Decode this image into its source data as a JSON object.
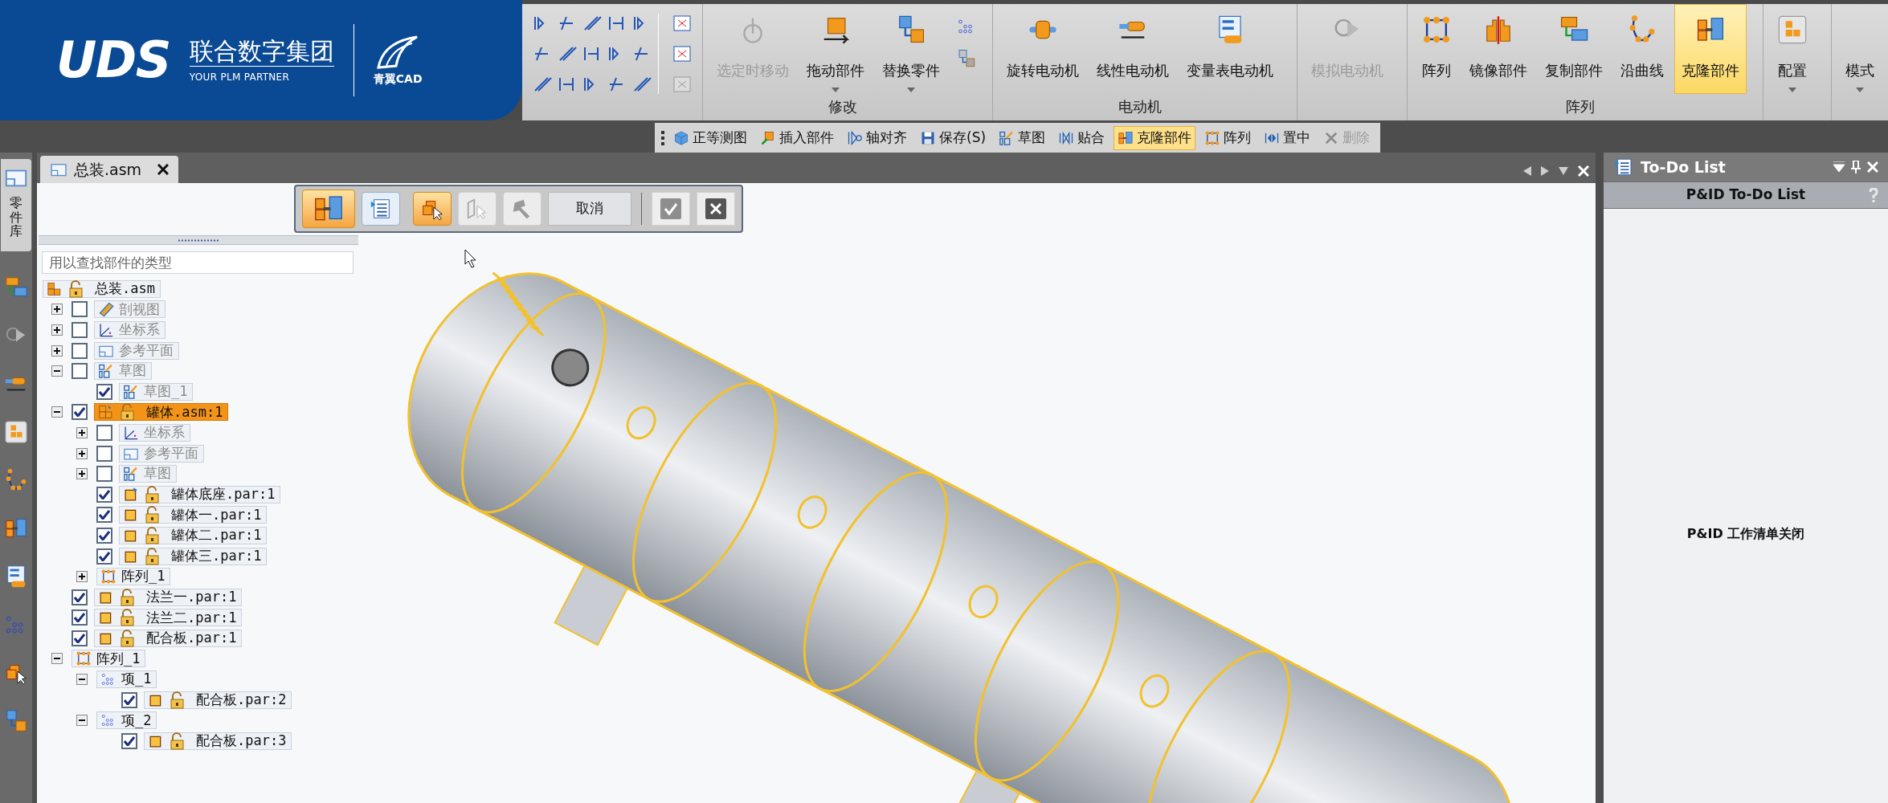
{
  "logo": {
    "brand": "UDS",
    "company": "联合数字集团",
    "tagline": "YOUR PLM PARTNER",
    "product": "青翼CAD"
  },
  "ribbon": {
    "groups": [
      {
        "label": "修改",
        "buttons": [
          {
            "label": "选定时移动",
            "kind": "move",
            "disabled": true,
            "selected": false,
            "dropdown": false
          },
          {
            "label": "拖动部件",
            "kind": "drag",
            "disabled": false,
            "selected": false,
            "dropdown": true
          },
          {
            "label": "替换零件",
            "kind": "replace",
            "disabled": false,
            "selected": false,
            "dropdown": true
          }
        ],
        "side_tools": true
      },
      {
        "label": "电动机",
        "buttons": [
          {
            "label": "旋转电动机",
            "kind": "rotary",
            "disabled": false,
            "selected": false,
            "dropdown": false
          },
          {
            "label": "线性电动机",
            "kind": "linear",
            "disabled": false,
            "selected": false,
            "dropdown": false
          },
          {
            "label": "变量表电动机",
            "kind": "table",
            "disabled": false,
            "selected": false,
            "dropdown": false
          }
        ],
        "side_tools": false
      },
      {
        "buttons": [
          {
            "label": "模拟电动机",
            "kind": "simulate",
            "disabled": true,
            "selected": false,
            "dropdown": false
          }
        ],
        "side_tools": false
      },
      {
        "label": "阵列",
        "buttons": [
          {
            "label": "阵列",
            "kind": "pattern",
            "disabled": false,
            "selected": false,
            "dropdown": false
          },
          {
            "label": "镜像部件",
            "kind": "mirror",
            "disabled": false,
            "selected": false,
            "dropdown": false
          },
          {
            "label": "复制部件",
            "kind": "copy",
            "disabled": false,
            "selected": false,
            "dropdown": false
          },
          {
            "label": "沿曲线",
            "kind": "curve",
            "disabled": false,
            "selected": false,
            "dropdown": false
          },
          {
            "label": "克隆部件",
            "kind": "clone",
            "disabled": false,
            "selected": true,
            "dropdown": false
          }
        ],
        "side_tools": false
      },
      {
        "buttons": [
          {
            "label": "配置",
            "kind": "config",
            "disabled": false,
            "selected": false,
            "dropdown": true
          }
        ],
        "side_tools": false
      },
      {
        "buttons": [
          {
            "label": "模式",
            "kind": "none",
            "disabled": false,
            "selected": false,
            "dropdown": true
          }
        ],
        "side_tools": false
      }
    ]
  },
  "quick_toolbar": [
    {
      "label": "正等测图",
      "kind": "cube",
      "selected": false,
      "disabled": false
    },
    {
      "label": "插入部件",
      "kind": "insert",
      "selected": false,
      "disabled": false
    },
    {
      "label": "轴对齐",
      "kind": "axis",
      "selected": false,
      "disabled": false
    },
    {
      "label": "保存(S)",
      "kind": "save",
      "selected": false,
      "disabled": false
    },
    {
      "label": "草图",
      "kind": "sketch",
      "selected": false,
      "disabled": false
    },
    {
      "label": "贴合",
      "kind": "mate",
      "selected": false,
      "disabled": false
    },
    {
      "label": "克隆部件",
      "kind": "clone",
      "selected": true,
      "disabled": false
    },
    {
      "label": "阵列",
      "kind": "pattern",
      "selected": false,
      "disabled": false
    },
    {
      "label": "置中",
      "kind": "center",
      "selected": false,
      "disabled": false
    },
    {
      "label": "删除",
      "kind": "delete",
      "selected": false,
      "disabled": true
    }
  ],
  "side_strip": {
    "tab": {
      "label": "零件库",
      "selected": true
    }
  },
  "document": {
    "tab": {
      "label": "总装.asm",
      "selected": true
    },
    "command_bar": {
      "buttons": [
        {
          "kind": "clone",
          "selected": true,
          "disabled": false
        },
        {
          "kind": "list",
          "selected": false,
          "disabled": false
        },
        {
          "kind": "select-parts",
          "selected": true,
          "disabled": false
        },
        {
          "kind": "select-face",
          "selected": false,
          "disabled": true
        },
        {
          "kind": "zone",
          "selected": false,
          "disabled": true
        }
      ],
      "cancel": "取消"
    },
    "search": {
      "placeholder": "用以查找部件的类型"
    },
    "tree": [
      {
        "label": "总装.asm",
        "kind": "assembly",
        "lock": true,
        "selected": false,
        "dimmed": false,
        "children": [
          {
            "label": "剖视图",
            "kind": "section",
            "lock": false,
            "checked": false,
            "expanded": false,
            "selected": false,
            "dimmed": true
          },
          {
            "label": "坐标系",
            "kind": "coords",
            "lock": false,
            "checked": false,
            "expanded": false,
            "selected": false,
            "dimmed": true
          },
          {
            "label": "参考平面",
            "kind": "plane",
            "lock": false,
            "checked": false,
            "expanded": false,
            "selected": false,
            "dimmed": true
          },
          {
            "label": "草图",
            "kind": "sketch",
            "lock": false,
            "checked": false,
            "expanded": true,
            "selected": false,
            "dimmed": true,
            "children": [
              {
                "label": "草图_1",
                "kind": "sketch",
                "lock": false,
                "checked": true,
                "selected": false,
                "dimmed": true
              }
            ]
          },
          {
            "label": "罐体.asm:1",
            "kind": "subassembly",
            "lock": true,
            "checked": true,
            "expanded": true,
            "selected": true,
            "dimmed": false,
            "children": [
              {
                "label": "坐标系",
                "kind": "coords",
                "lock": false,
                "checked": false,
                "expanded": false,
                "selected": false,
                "dimmed": true
              },
              {
                "label": "参考平面",
                "kind": "plane",
                "lock": false,
                "checked": false,
                "expanded": false,
                "selected": false,
                "dimmed": true
              },
              {
                "label": "草图",
                "kind": "sketch",
                "lock": false,
                "checked": false,
                "expanded": false,
                "selected": false,
                "dimmed": true
              },
              {
                "label": "罐体底座.par:1",
                "kind": "part-base",
                "lock": true,
                "checked": true,
                "selected": false,
                "dimmed": false
              },
              {
                "label": "罐体一.par:1",
                "kind": "part",
                "lock": true,
                "checked": true,
                "selected": false,
                "dimmed": false
              },
              {
                "label": "罐体二.par:1",
                "kind": "part",
                "lock": true,
                "checked": true,
                "selected": false,
                "dimmed": false
              },
              {
                "label": "罐体三.par:1",
                "kind": "part",
                "lock": true,
                "checked": true,
                "selected": false,
                "dimmed": false
              },
              {
                "label": "阵列_1",
                "kind": "pattern",
                "lock": false,
                "expanded": false,
                "selected": false,
                "dimmed": false
              }
            ]
          },
          {
            "label": "法兰一.par:1",
            "kind": "part",
            "lock": true,
            "checked": true,
            "selected": false,
            "dimmed": false
          },
          {
            "label": "法兰二.par:1",
            "kind": "part",
            "lock": true,
            "checked": true,
            "selected": false,
            "dimmed": false
          },
          {
            "label": "配合板.par:1",
            "kind": "part",
            "lock": true,
            "checked": true,
            "selected": false,
            "dimmed": false
          },
          {
            "label": "阵列_1",
            "kind": "pattern",
            "lock": false,
            "expanded": true,
            "selected": false,
            "dimmed": false,
            "children": [
              {
                "label": "项_1",
                "kind": "pattern-item",
                "lock": false,
                "expanded": true,
                "selected": false,
                "dimmed": false,
                "children": [
                  {
                    "label": "配合板.par:2",
                    "kind": "part",
                    "lock": true,
                    "checked": true,
                    "selected": false,
                    "dimmed": false
                  }
                ]
              },
              {
                "label": "项_2",
                "kind": "pattern-item",
                "lock": false,
                "expanded": true,
                "selected": false,
                "dimmed": false,
                "children": [
                  {
                    "label": "配合板.par:3",
                    "kind": "part",
                    "lock": true,
                    "checked": true,
                    "selected": false,
                    "dimmed": false
                  }
                ]
              }
            ]
          }
        ]
      }
    ]
  },
  "todo_panel": {
    "title": "To-Do List",
    "subtitle": "P&ID To-Do List",
    "message": "P&ID 工作清单关闭"
  }
}
